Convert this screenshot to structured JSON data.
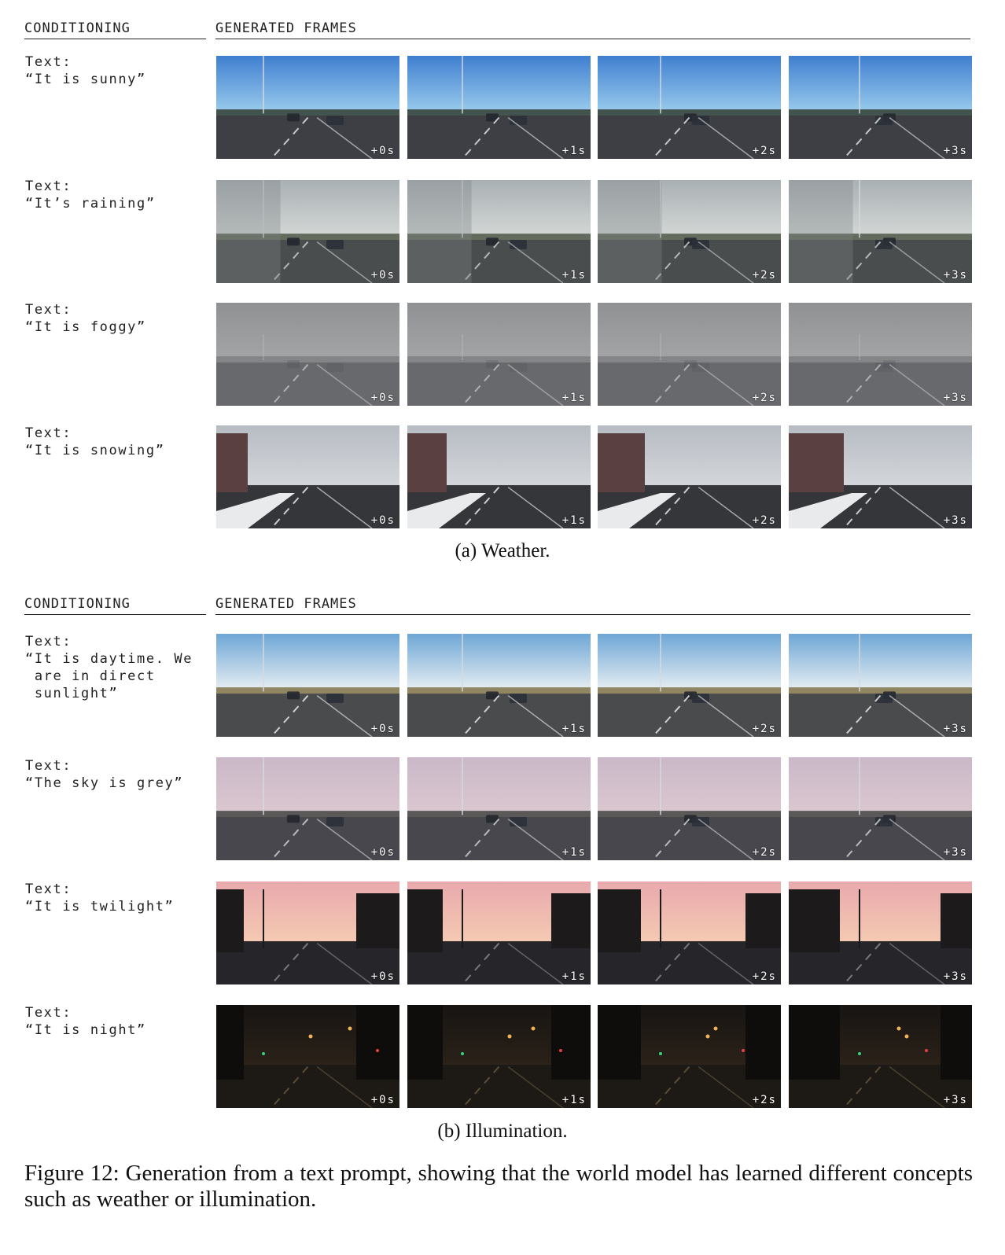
{
  "panels": [
    {
      "conditioning_header": "CONDITIONING",
      "frames_header": "GENERATED FRAMES",
      "rows": [
        {
          "label": "Text:",
          "prompt": "“It is sunny”",
          "frame_style": "sunny"
        },
        {
          "label": "Text:",
          "prompt": "“It’s raining”",
          "frame_style": "rain"
        },
        {
          "label": "Text:",
          "prompt": "“It is foggy”",
          "frame_style": "fog"
        },
        {
          "label": "Text:",
          "prompt": "“It is snowing”",
          "frame_style": "snow"
        }
      ],
      "caption": "(a) Weather."
    },
    {
      "conditioning_header": "CONDITIONING",
      "frames_header": "GENERATED FRAMES",
      "rows": [
        {
          "label": "Text:",
          "prompt": "“It is daytime. We\n are in direct\n sunlight”",
          "frame_style": "daylight"
        },
        {
          "label": "Text:",
          "prompt": "“The sky is grey”",
          "frame_style": "grey"
        },
        {
          "label": "Text:",
          "prompt": "“It is twilight”",
          "frame_style": "twilight"
        },
        {
          "label": "Text:",
          "prompt": "“It is night”",
          "frame_style": "night"
        }
      ],
      "caption": "(b) Illumination."
    }
  ],
  "timestamps": [
    "+0s",
    "+1s",
    "+2s",
    "+3s"
  ],
  "figure_caption": "Figure 12: Generation from a text prompt, showing that the world model has learned different concepts such as weather or illumination.",
  "frame_palettes": {
    "sunny": {
      "sky_top": "#3f7fd0",
      "sky_bottom": "#9fd0ee",
      "ground": "#3d3f44",
      "side": "#2d3426",
      "line": "#e8e8e8"
    },
    "rain": {
      "sky_top": "#a9b0b3",
      "sky_bottom": "#d6dad8",
      "ground": "#4a4d4e",
      "side": "#46503f",
      "line": "#cfd2d2"
    },
    "fog": {
      "sky_top": "#8b8d8f",
      "sky_bottom": "#a9abad",
      "ground": "#4d4f52",
      "side": "#6c6e70",
      "line": "#d8d8d8"
    },
    "snow": {
      "sky_top": "#b7bcc3",
      "sky_bottom": "#d3d6da",
      "ground": "#35363a",
      "side": "#5a4040",
      "line": "#f2f2f2"
    },
    "daylight": {
      "sky_top": "#6ea6d6",
      "sky_bottom": "#eef3f4",
      "ground": "#4a4b4d",
      "side": "#7a6a3d",
      "line": "#f0f0f0"
    },
    "grey": {
      "sky_top": "#cbb8c8",
      "sky_bottom": "#dbc8d0",
      "ground": "#48474d",
      "side": "#3a3d3a",
      "line": "#d7d7d7"
    },
    "twilight": {
      "sky_top": "#e9a9ad",
      "sky_bottom": "#f4c9b2",
      "ground": "#26262a",
      "side": "#1c1a1b",
      "line": "#8d8d8d"
    },
    "night": {
      "sky_top": "#171412",
      "sky_bottom": "#2b2219",
      "ground": "#1d1915",
      "side": "#0f0d0b",
      "line": "#6a5a40"
    }
  }
}
